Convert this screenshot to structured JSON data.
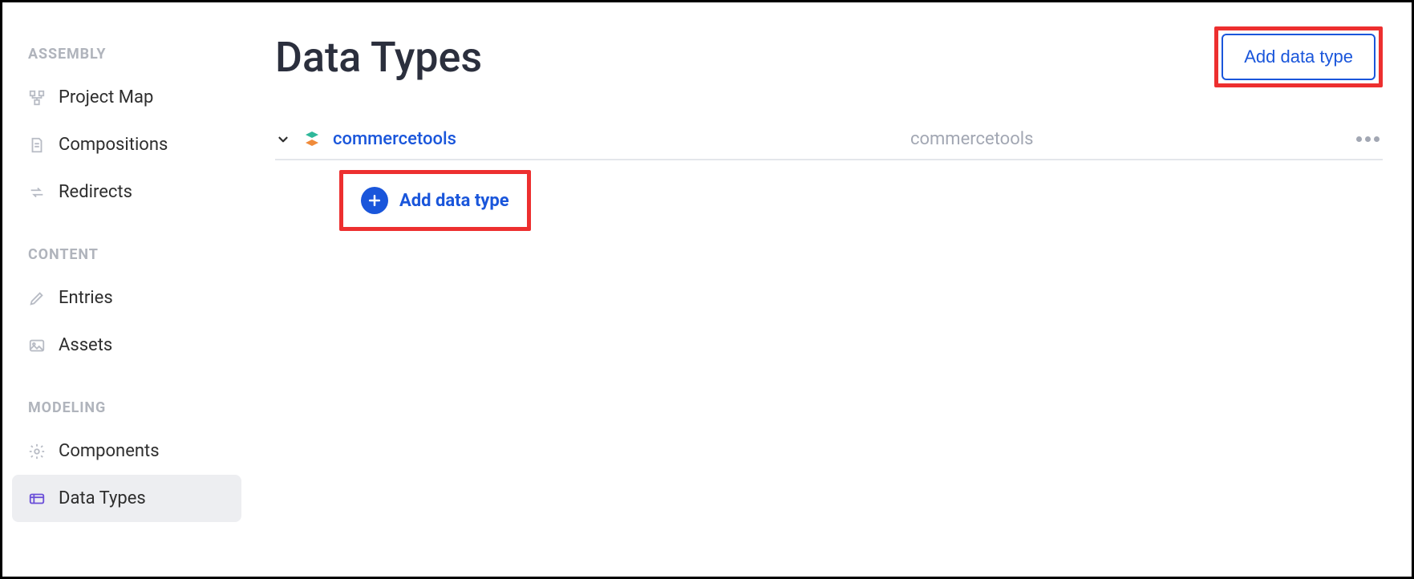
{
  "sidebar": {
    "sections": [
      {
        "title": "ASSEMBLY",
        "items": [
          {
            "label": "Project Map",
            "icon": "sitemap-icon",
            "active": false
          },
          {
            "label": "Compositions",
            "icon": "file-icon",
            "active": false
          },
          {
            "label": "Redirects",
            "icon": "redirect-icon",
            "active": false
          }
        ]
      },
      {
        "title": "CONTENT",
        "items": [
          {
            "label": "Entries",
            "icon": "pencil-icon",
            "active": false
          },
          {
            "label": "Assets",
            "icon": "image-icon",
            "active": false
          }
        ]
      },
      {
        "title": "MODELING",
        "items": [
          {
            "label": "Components",
            "icon": "gear-icon",
            "active": false
          },
          {
            "label": "Data Types",
            "icon": "cards-icon",
            "active": true
          }
        ]
      }
    ]
  },
  "main": {
    "page_title": "Data Types",
    "add_button_label": "Add data type",
    "source": {
      "name": "commercetools",
      "slug": "commercetools",
      "add_child_label": "Add data type"
    }
  }
}
